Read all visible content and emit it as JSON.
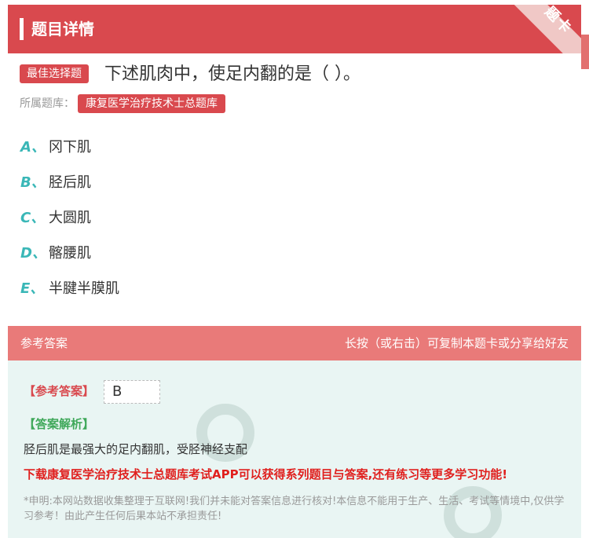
{
  "header": {
    "title": "题目详情",
    "badge": "题卡"
  },
  "question": {
    "type_tag": "最佳选择题",
    "text": "下述肌肉中，使足内翻的是（ ）。",
    "bank_label": "所属题库：",
    "bank_name": "康复医学治疗技术士总题库"
  },
  "options": [
    {
      "letter": "A、",
      "text": "冈下肌"
    },
    {
      "letter": "B、",
      "text": "胫后肌"
    },
    {
      "letter": "C、",
      "text": "大圆肌"
    },
    {
      "letter": "D、",
      "text": "髂腰肌"
    },
    {
      "letter": "E、",
      "text": "半腱半膜肌"
    }
  ],
  "answer_section": {
    "header_left": "参考答案",
    "header_right": "长按（或右击）可复制本题卡或分享给好友",
    "ref_label": "【参考答案】",
    "answer": "B",
    "analysis_label": "【答案解析】",
    "analysis": "胫后肌是最强大的足内翻肌，受胫神经支配",
    "promo": "下载康复医学治疗技术士总题库考试APP可以获得系列题目与答案,还有练习等更多学习功能!",
    "disclaimer": "*申明:本网站数据收集整理于互联网!我们并未能对答案信息进行核对!本信息不能用于生产、生活、考试等情境中,仅供学习参考！由此产生任何后果本站不承担责任!"
  },
  "colors": {
    "brand_red": "#d9494e",
    "teal": "#3ab7b7",
    "answer_bg": "#e9f5f3"
  }
}
